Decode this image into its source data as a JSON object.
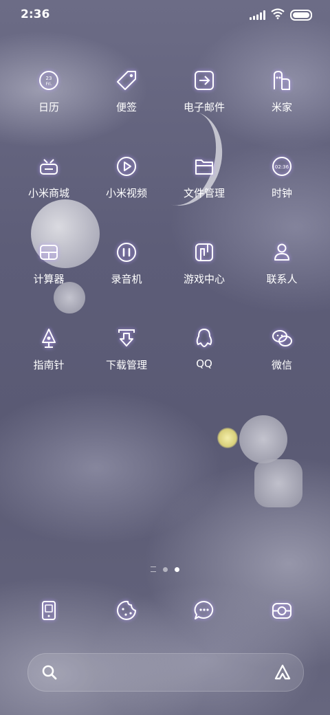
{
  "status_bar": {
    "time": "2:36"
  },
  "apps": [
    {
      "label": "日历",
      "icon": "calendar-icon"
    },
    {
      "label": "便签",
      "icon": "notes-tag-icon"
    },
    {
      "label": "电子邮件",
      "icon": "email-icon"
    },
    {
      "label": "米家",
      "icon": "mijia-home-icon"
    },
    {
      "label": "小米商城",
      "icon": "mi-store-icon"
    },
    {
      "label": "小米视频",
      "icon": "video-play-icon"
    },
    {
      "label": "文件管理",
      "icon": "folder-icon"
    },
    {
      "label": "时钟",
      "icon": "clock-icon"
    },
    {
      "label": "计算器",
      "icon": "calculator-icon"
    },
    {
      "label": "录音机",
      "icon": "recorder-icon"
    },
    {
      "label": "游戏中心",
      "icon": "game-center-icon"
    },
    {
      "label": "联系人",
      "icon": "contacts-icon"
    },
    {
      "label": "指南针",
      "icon": "compass-icon"
    },
    {
      "label": "下载管理",
      "icon": "download-icon"
    },
    {
      "label": "QQ",
      "icon": "qq-penguin-icon"
    },
    {
      "label": "微信",
      "icon": "wechat-icon"
    }
  ],
  "calendar_icon": {
    "day": "23",
    "weekday": "Fri."
  },
  "clock_icon": {
    "time": "02:36"
  },
  "dock": [
    {
      "icon": "phone-icon"
    },
    {
      "icon": "cookie-browser-icon"
    },
    {
      "icon": "message-bubble-icon"
    },
    {
      "icon": "camera-icon"
    }
  ],
  "pager": {
    "pages": 2,
    "current": 2
  },
  "search": {
    "left_icon": "search-icon",
    "right_icon": "assistant-icon"
  },
  "colors": {
    "icon_glow": "#b79cff",
    "icon_stroke": "#ffffff"
  }
}
